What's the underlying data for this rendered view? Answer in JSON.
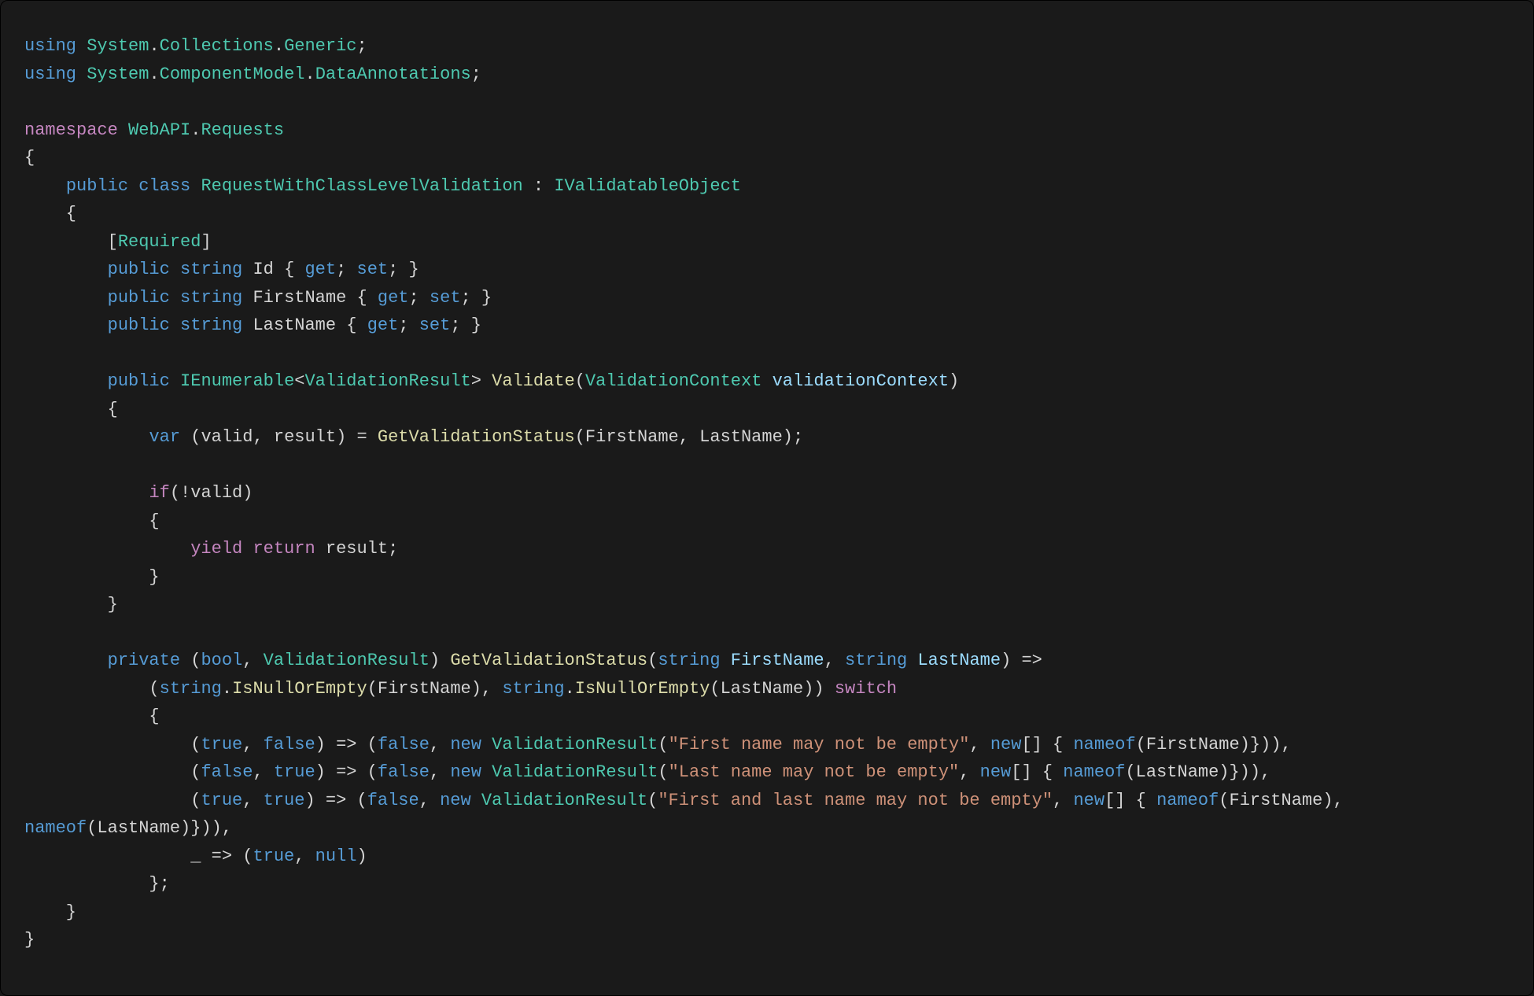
{
  "tokens": {
    "t0": "using",
    "t1": " ",
    "t2": "System",
    "t3": ".",
    "t4": "Collections",
    "t5": ".",
    "t6": "Generic",
    "t7": ";",
    "t8": "using",
    "t9": " ",
    "t10": "System",
    "t11": ".",
    "t12": "ComponentModel",
    "t13": ".",
    "t14": "DataAnnotations",
    "t15": ";",
    "t16": "namespace",
    "t17": " ",
    "t18": "WebAPI",
    "t19": ".",
    "t20": "Requests",
    "t21": "{",
    "t22": "    ",
    "t23": "public",
    "t24": " ",
    "t25": "class",
    "t26": " ",
    "t27": "RequestWithClassLevelValidation",
    "t28": " : ",
    "t29": "IValidatableObject",
    "t30": "    {",
    "t31": "        [",
    "t32": "Required",
    "t33": "]",
    "t34": "        ",
    "t35": "public",
    "t36": " ",
    "t37": "string",
    "t38": " ",
    "t39": "Id",
    "t40": " { ",
    "t41": "get",
    "t42": "; ",
    "t43": "set",
    "t44": "; }",
    "t45": "        ",
    "t46": "public",
    "t47": " ",
    "t48": "string",
    "t49": " ",
    "t50": "FirstName",
    "t51": " { ",
    "t52": "get",
    "t53": "; ",
    "t54": "set",
    "t55": "; }",
    "t56": "        ",
    "t57": "public",
    "t58": " ",
    "t59": "string",
    "t60": " ",
    "t61": "LastName",
    "t62": " { ",
    "t63": "get",
    "t64": "; ",
    "t65": "set",
    "t66": "; }",
    "t67": "        ",
    "t68": "public",
    "t69": " ",
    "t70": "IEnumerable",
    "t71": "<",
    "t72": "ValidationResult",
    "t73": "> ",
    "t74": "Validate",
    "t75": "(",
    "t76": "ValidationContext",
    "t77": " ",
    "t78": "validationContext",
    "t79": ")",
    "t80": "        {",
    "t81": "            ",
    "t82": "var",
    "t83": " (valid, result) = ",
    "t84": "GetValidationStatus",
    "t85": "(FirstName, LastName);",
    "t86": "            ",
    "t87": "if",
    "t88": "(!valid)",
    "t89": "            {",
    "t90": "                ",
    "t91": "yield",
    "t92": " ",
    "t93": "return",
    "t94": " result;",
    "t95": "            }",
    "t96": "        }",
    "t97": "        ",
    "t98": "private",
    "t99": " (",
    "t100": "bool",
    "t101": ", ",
    "t102": "ValidationResult",
    "t103": ") ",
    "t104": "GetValidationStatus",
    "t105": "(",
    "t106": "string",
    "t107": " ",
    "t108": "FirstName",
    "t109": ", ",
    "t110": "string",
    "t111": " ",
    "t112": "LastName",
    "t113": ") =>",
    "t114": "            (",
    "t115": "string",
    "t116": ".",
    "t117": "IsNullOrEmpty",
    "t118": "(FirstName), ",
    "t119": "string",
    "t120": ".",
    "t121": "IsNullOrEmpty",
    "t122": "(LastName)) ",
    "t123": "switch",
    "t124": "            {",
    "t125": "                (",
    "t126": "true",
    "t127": ", ",
    "t128": "false",
    "t129": ") => (",
    "t130": "false",
    "t131": ", ",
    "t132": "new",
    "t133": " ",
    "t134": "ValidationResult",
    "t135": "(",
    "t136": "\"First name may not be empty\"",
    "t137": ", ",
    "t138": "new",
    "t139": "[] { ",
    "t140": "nameof",
    "t141": "(FirstName)})),",
    "t142": "                (",
    "t143": "false",
    "t144": ", ",
    "t145": "true",
    "t146": ") => (",
    "t147": "false",
    "t148": ", ",
    "t149": "new",
    "t150": " ",
    "t151": "ValidationResult",
    "t152": "(",
    "t153": "\"Last name may not be empty\"",
    "t154": ", ",
    "t155": "new",
    "t156": "[] { ",
    "t157": "nameof",
    "t158": "(LastName)})),",
    "t159": "                (",
    "t160": "true",
    "t161": ", ",
    "t162": "true",
    "t163": ") => (",
    "t164": "false",
    "t165": ", ",
    "t166": "new",
    "t167": " ",
    "t168": "ValidationResult",
    "t169": "(",
    "t170": "\"First and last name may not be empty\"",
    "t171": ", ",
    "t172": "new",
    "t173": "[] { ",
    "t174": "nameof",
    "t175": "(FirstName), ",
    "t176": "nameof",
    "t177": "(LastName)})),",
    "t178": "                _ => (",
    "t179": "true",
    "t180": ", ",
    "t181": "null",
    "t182": ")",
    "t183": "            };",
    "t184": "    }",
    "t185": "}"
  }
}
